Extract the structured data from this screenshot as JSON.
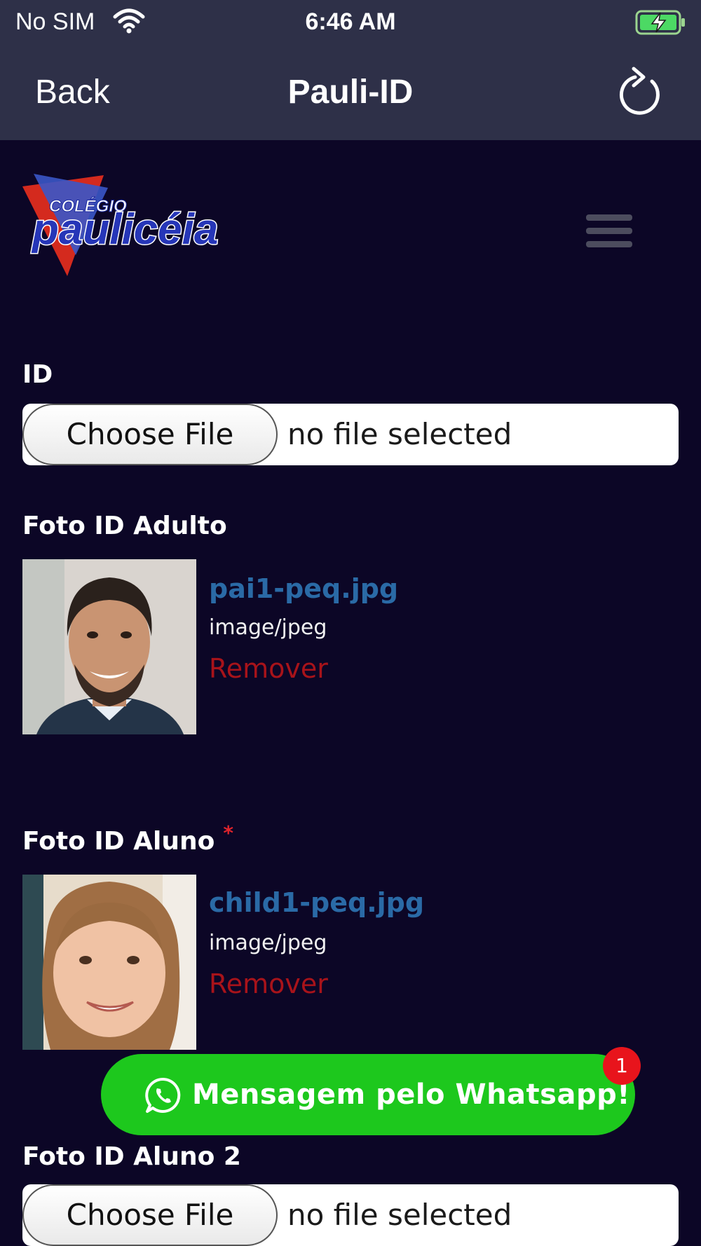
{
  "status_bar": {
    "carrier": "No SIM",
    "time": "6:46 AM"
  },
  "nav": {
    "back_label": "Back",
    "title": "Pauli-ID"
  },
  "logo": {
    "top_text": "COLÉGIO",
    "main_text": "paulicéia"
  },
  "form": {
    "id_field": {
      "label": "ID",
      "choose_label": "Choose File",
      "status": "no file selected"
    },
    "adult_photo": {
      "label": "Foto ID Adulto",
      "file_name": "pai1-peq.jpg",
      "file_type": "image/jpeg",
      "remove_label": "Remover"
    },
    "student_photo": {
      "label": "Foto ID Aluno",
      "required_mark": "*",
      "file_name": "child1-peq.jpg",
      "file_type": "image/jpeg",
      "remove_label": "Remover"
    },
    "student_photo_2": {
      "label": "Foto ID Aluno 2",
      "choose_label": "Choose File",
      "status": "no file selected"
    }
  },
  "whatsapp": {
    "label": "Mensagem pelo Whatsapp!",
    "badge_count": "1"
  },
  "colors": {
    "background": "#0c0626",
    "header": "#2e3048",
    "link_blue": "#2a6aa6",
    "remove_red": "#a8131a",
    "whatsapp_green": "#1dc81d",
    "badge_red": "#e8141c"
  }
}
